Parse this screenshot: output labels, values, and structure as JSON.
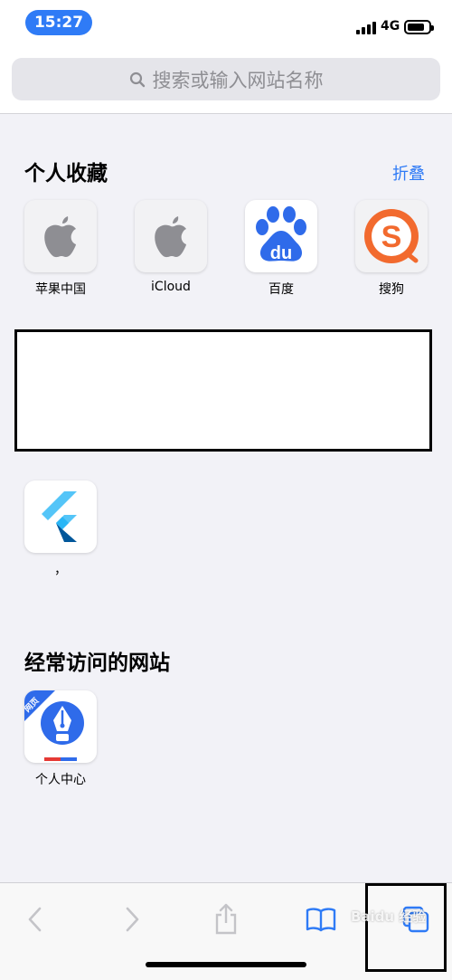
{
  "status_bar": {
    "time": "15:27",
    "network": "4G"
  },
  "search": {
    "placeholder": "搜索或输入网站名称"
  },
  "favorites": {
    "title": "个人收藏",
    "fold_label": "折叠",
    "items": [
      {
        "label": "苹果中国",
        "icon": "apple-logo-icon"
      },
      {
        "label": "iCloud",
        "icon": "apple-logo-icon"
      },
      {
        "label": "百度",
        "icon": "baidu-paw-icon"
      },
      {
        "label": "搜狗",
        "icon": "sogou-s-icon"
      }
    ],
    "extra_item": {
      "label": "，",
      "icon": "flutter-logo-icon"
    }
  },
  "frequent": {
    "title": "经常访问的网站",
    "items": [
      {
        "label": "个人中心",
        "icon": "pen-nib-icon",
        "badge": "网页"
      }
    ]
  },
  "toolbar": {
    "buttons": [
      "back-icon",
      "forward-icon",
      "share-icon",
      "bookmarks-icon",
      "tabs-icon"
    ]
  },
  "watermark": "Baidu 经验",
  "colors": {
    "accent": "#2F7BF6",
    "background": "#F2F2F7",
    "baidu_blue": "#2F6BEA",
    "sogou_orange": "#F26A2E"
  }
}
